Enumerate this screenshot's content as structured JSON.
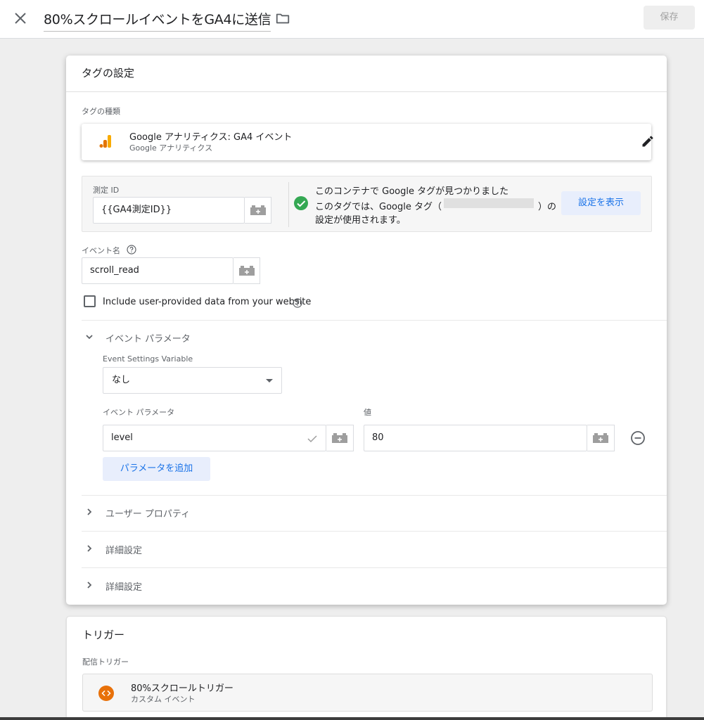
{
  "header": {
    "title": "80%スクロールイベントをGA4に送信",
    "save_label": "保存"
  },
  "tag_config": {
    "title": "タグの設定",
    "tag_type_label": "タグの種類",
    "tag_type": {
      "name": "Google アナリティクス: GA4 イベント",
      "sub": "Google アナリティクス"
    },
    "measurement": {
      "label": "測定 ID",
      "value": "{{GA4測定ID}}",
      "found_line1": "このコンテナで Google タグが見つかりました",
      "found_line2a": "このタグでは、Google タグ（",
      "found_line2b": "）の",
      "found_line3": "設定が使用されます。",
      "show_button": "設定を表示"
    },
    "event_name": {
      "label": "イベント名",
      "value": "scroll_read"
    },
    "include_user_data_label": "Include user-provided data from your website",
    "event_params_section": {
      "title": "イベント パラメータ",
      "settings_variable_label": "Event Settings Variable",
      "settings_variable_value": "なし",
      "param_col_label": "イベント パラメータ",
      "value_col_label": "値",
      "rows": [
        {
          "param": "level",
          "value": "80"
        }
      ],
      "add_button": "パラメータを追加"
    },
    "collapsed_sections": [
      {
        "title": "ユーザー プロパティ"
      },
      {
        "title": "詳細設定"
      },
      {
        "title": "詳細設定"
      }
    ]
  },
  "trigger": {
    "title": "トリガー",
    "firing_label": "配信トリガー",
    "items": [
      {
        "name": "80%スクロールトリガー",
        "sub": "カスタム イベント"
      }
    ]
  },
  "colors": {
    "accent_blue": "#1a73e8",
    "check_green": "#34a853",
    "trigger_orange": "#e8710a",
    "ga_orange": "#f9ab00",
    "ga_dark_orange": "#e37400"
  }
}
